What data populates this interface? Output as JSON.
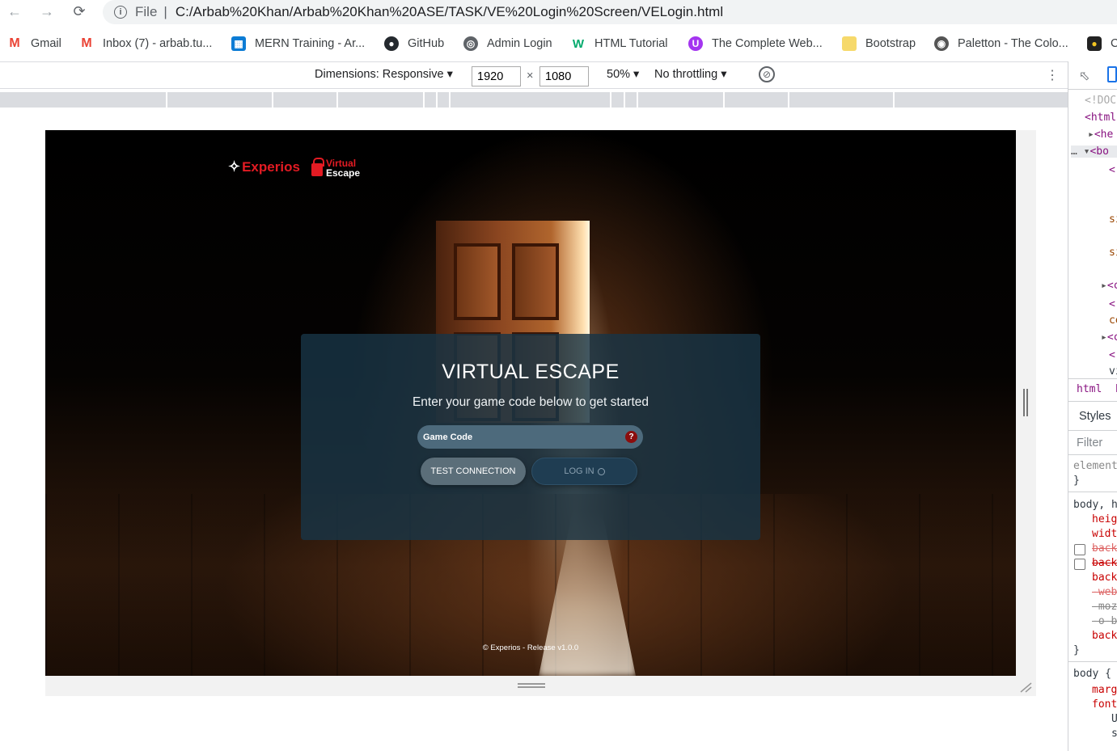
{
  "browser": {
    "scheme_label": "File",
    "url": "C:/Arbab%20Khan/Arbab%20Khan%20ASE/TASK/VE%20Login%20Screen/VELogin.html"
  },
  "bookmarks": [
    {
      "label": "Gmail",
      "icon": "gmail-icon"
    },
    {
      "label": "Inbox (7) - arbab.tu...",
      "icon": "gmail-icon"
    },
    {
      "label": "MERN Training - Ar...",
      "icon": "trello-icon"
    },
    {
      "label": "GitHub",
      "icon": "github-icon"
    },
    {
      "label": "Admin Login",
      "icon": "globe-icon"
    },
    {
      "label": "HTML Tutorial",
      "icon": "w3schools-icon"
    },
    {
      "label": "The Complete Web...",
      "icon": "udemy-icon"
    },
    {
      "label": "Bootstrap",
      "icon": "folder-icon"
    },
    {
      "label": "Paletton - The Colo...",
      "icon": "paletton-icon"
    },
    {
      "label": "C",
      "icon": "shield-icon"
    }
  ],
  "device_toolbar": {
    "dimensions_label": "Dimensions: Responsive",
    "width": "1920",
    "height": "1080",
    "times": "×",
    "zoom": "50%",
    "throttling": "No throttling"
  },
  "page": {
    "brand1": "Experios",
    "brand2_top": "Virtual",
    "brand2_bottom": "Escape",
    "title": "VIRTUAL ESCAPE",
    "subtitle": "Enter your game code below to get started",
    "code_placeholder": "Game Code",
    "help_symbol": "?",
    "test_button": "TEST CONNECTION",
    "login_button": "LOG IN",
    "footer": "© Experios - Release v1.0.0"
  },
  "devtools": {
    "elements": [
      "<!DOC",
      "<html",
      "<he",
      "<bo",
      "<",
      "sı",
      "sı",
      "<c",
      "<",
      "ce",
      "<c",
      "<!",
      "vi"
    ],
    "tabs": [
      "html",
      "b"
    ],
    "styles_tab": "Styles",
    "filter_placeholder": "Filter",
    "style_lines": [
      "element",
      "}",
      "body, h",
      "heig",
      "widt",
      "back",
      "back",
      "back",
      "-web",
      "-moz",
      "-o-b",
      "back",
      "}",
      "body {",
      "marg",
      "font",
      "U",
      "s"
    ]
  }
}
